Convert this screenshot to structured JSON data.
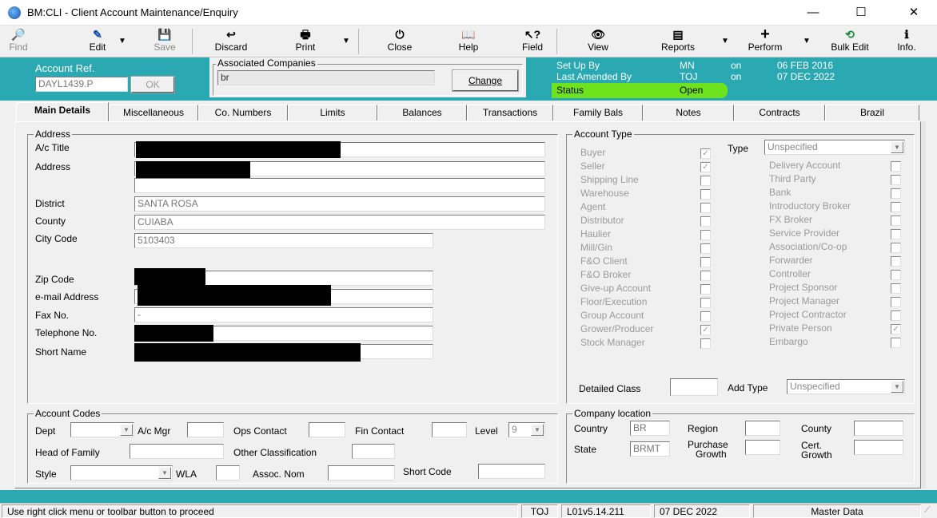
{
  "window": {
    "title": "BM:CLI - Client Account Maintenance/Enquiry",
    "minimize": "—",
    "maximize": "☐",
    "close": "✕"
  },
  "toolbar": [
    {
      "id": "find",
      "label": "Find",
      "icon": "🔎",
      "disabled": true
    },
    {
      "id": "edit",
      "label": "Edit",
      "icon": "✎",
      "disabled": false
    },
    {
      "id": "save",
      "label": "Save",
      "icon": "💾",
      "disabled": true
    },
    {
      "id": "discard",
      "label": "Discard",
      "icon": "↩",
      "disabled": false
    },
    {
      "id": "print",
      "label": "Print",
      "icon": "🖶",
      "disabled": false
    },
    {
      "id": "close",
      "label": "Close",
      "icon": "⏻",
      "disabled": false
    },
    {
      "id": "help",
      "label": "Help",
      "icon": "📖",
      "disabled": false
    },
    {
      "id": "field",
      "label": "Field",
      "icon": "↖?",
      "disabled": false
    },
    {
      "id": "view",
      "label": "View",
      "icon": "👁",
      "disabled": false
    },
    {
      "id": "reports",
      "label": "Reports",
      "icon": "▤",
      "disabled": false
    },
    {
      "id": "perform",
      "label": "Perform",
      "icon": "+",
      "disabled": false
    },
    {
      "id": "bulk_edit",
      "label": "Bulk Edit",
      "icon": "⟲",
      "disabled": false
    },
    {
      "id": "info",
      "label": "Info.",
      "icon": "ℹ",
      "disabled": false
    }
  ],
  "header": {
    "account_ref_label": "Account Ref.",
    "account_ref_value": "DAYL1439.P",
    "ok_label": "OK",
    "associated_companies_label": "Associated Companies",
    "associated_companies_value": "br",
    "change_label": "Change",
    "set_up_by_label": "Set Up By",
    "set_up_by_value": "MN",
    "set_up_on": "on",
    "set_up_date": "06 FEB 2016",
    "last_amended_label": "Last Amended By",
    "last_amended_value": "TOJ",
    "last_amended_on": "on",
    "last_amended_date": "07 DEC 2022",
    "status_label": "Status",
    "status_value": "Open"
  },
  "tabs": [
    "Main Details",
    "Miscellaneous",
    "Co. Numbers",
    "Limits",
    "Balances",
    "Transactions",
    "Family Bals",
    "Notes",
    "Contracts",
    "Brazil"
  ],
  "address": {
    "group_label": "Address",
    "ac_title_label": "A/c Title",
    "address_label": "Address",
    "district_label": "District",
    "district_value": "SANTA ROSA",
    "county_label": "County",
    "county_value": "CUIABA",
    "city_code_label": "City Code",
    "city_code_value": "5103403",
    "zip_label": "Zip Code",
    "email_label": "e-mail Address",
    "fax_label": "Fax No.",
    "fax_value": "-",
    "tel_label": "Telephone No.",
    "short_name_label": "Short Name"
  },
  "account_type": {
    "group_label": "Account Type",
    "type_label": "Type",
    "type_value": "Unspecified",
    "left": [
      {
        "label": "Buyer",
        "checked": true
      },
      {
        "label": "Seller",
        "checked": true
      },
      {
        "label": "Shipping Line",
        "checked": false
      },
      {
        "label": "Warehouse",
        "checked": false
      },
      {
        "label": "Agent",
        "checked": false
      },
      {
        "label": "Distributor",
        "checked": false
      },
      {
        "label": "Haulier",
        "checked": false
      },
      {
        "label": "Mill/Gin",
        "checked": false
      },
      {
        "label": "F&O Client",
        "checked": false
      },
      {
        "label": "F&O Broker",
        "checked": false
      },
      {
        "label": "Give-up Account",
        "checked": false
      },
      {
        "label": "Floor/Execution",
        "checked": false
      },
      {
        "label": "Group Account",
        "checked": false
      },
      {
        "label": "Grower/Producer",
        "checked": true
      },
      {
        "label": "Stock Manager",
        "checked": false
      }
    ],
    "right": [
      {
        "label": "Delivery Account",
        "checked": false
      },
      {
        "label": "Third Party",
        "checked": false
      },
      {
        "label": "Bank",
        "checked": false
      },
      {
        "label": "Introductory Broker",
        "checked": false
      },
      {
        "label": "FX Broker",
        "checked": false
      },
      {
        "label": "Service Provider",
        "checked": false
      },
      {
        "label": "Association/Co-op",
        "checked": false
      },
      {
        "label": "Forwarder",
        "checked": false
      },
      {
        "label": "Controller",
        "checked": false
      },
      {
        "label": "Project Sponsor",
        "checked": false
      },
      {
        "label": "Project Manager",
        "checked": false
      },
      {
        "label": "Project Contractor",
        "checked": false
      },
      {
        "label": "Private Person",
        "checked": true
      },
      {
        "label": "Embargo",
        "checked": false
      }
    ],
    "detailed_class_label": "Detailed Class",
    "add_type_label": "Add Type",
    "add_type_value": "Unspecified"
  },
  "account_codes": {
    "group_label": "Account Codes",
    "dept_label": "Dept",
    "ac_mgr_label": "A/c Mgr",
    "ops_contact_label": "Ops Contact",
    "fin_contact_label": "Fin Contact",
    "level_label": "Level",
    "level_value": "9",
    "head_family_label": "Head of Family",
    "other_class_label": "Other Classification",
    "style_label": "Style",
    "wla_label": "WLA",
    "assoc_nom_label": "Assoc. Nom",
    "short_code_label": "Short Code"
  },
  "company_location": {
    "group_label": "Company location",
    "country_label": "Country",
    "country_value": "BR",
    "region_label": "Region",
    "county_label": "County",
    "state_label": "State",
    "state_value": "BRMT",
    "purchase_growth_label_1": "Purchase",
    "purchase_growth_label_2": "Growth",
    "cert_growth_label_1": "Cert.",
    "cert_growth_label_2": "Growth"
  },
  "statusbar": {
    "message": "Use right click menu or toolbar button to proceed",
    "user": "TOJ",
    "version": "L01v5.14.211",
    "date": "07 DEC 2022",
    "module": "Master Data"
  }
}
